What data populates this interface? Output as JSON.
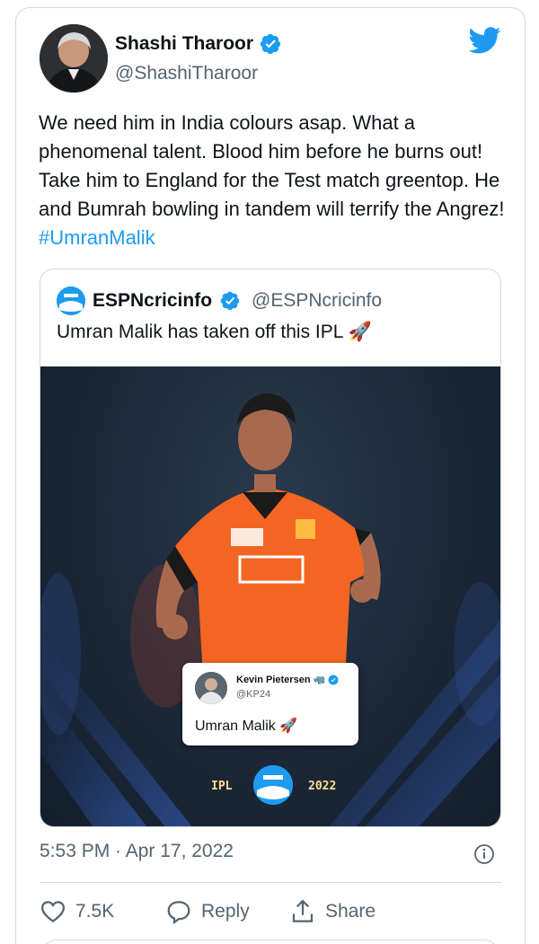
{
  "tweet": {
    "author_name": "Shashi Tharoor",
    "author_handle": "@ShashiTharoor",
    "text": "We need him in India colours asap. What a phenomenal talent. Blood him before he burns out! Take him to England for the Test match greentop. He and Bumrah bowling in tandem will terrify the Angrez! ",
    "hashtag": "#UmranMalik",
    "timestamp": "5:53 PM · Apr 17, 2022"
  },
  "quote": {
    "author_name": "ESPNcricinfo",
    "author_handle": "@ESPNcricinfo",
    "text": "Umran Malik has taken off this IPL 🚀",
    "media": {
      "embedded_tweet": {
        "author_name": "Kevin Pietersen",
        "author_emoji": "🦏",
        "author_handle": "@KP24",
        "text": "Umran Malik 🚀"
      },
      "left_label": "IPL",
      "right_label": "2022",
      "logo_text": "ESPN cricinfo"
    }
  },
  "actions": {
    "like_count": "7.5K",
    "reply_label": "Reply",
    "share_label": "Share"
  },
  "colors": {
    "accent": "#1d9bf0",
    "secondary_text": "#536471",
    "border": "#cfd9de",
    "jersey": "#f26522"
  },
  "icons": [
    "verified-badge-icon",
    "twitter-bird-icon",
    "info-icon",
    "heart-icon",
    "reply-bubble-icon",
    "share-icon"
  ]
}
